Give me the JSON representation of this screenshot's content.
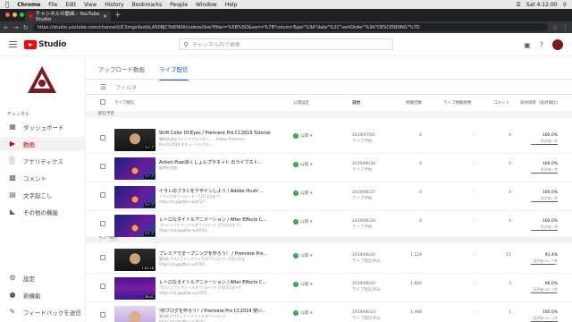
{
  "os_menu": {
    "app": "Chrome",
    "items": [
      "File",
      "Edit",
      "View",
      "History",
      "Bookmarks",
      "People",
      "Window",
      "Help"
    ],
    "clock": "Sat 4:12:00"
  },
  "browser": {
    "tab_title": "チャンネルの動画 - YouTube Studio",
    "url": "https://studio.youtube.com/channel/UCSmgx9sstkLAS0BJCYbEN0A/videos/live?filter=%5B%5D&sort=%7B\"columnType\"%3A\"date\"%2C\"sortOrder\"%3A\"DESCENDING\"%7D"
  },
  "header": {
    "logo_text": "Studio",
    "search_placeholder": "チャンネル内で検索"
  },
  "sidebar": {
    "section_label": "チャンネル",
    "items": [
      {
        "label": "ダッシュボード",
        "icon": "dashboard-icon"
      },
      {
        "label": "動画",
        "icon": "video-icon"
      },
      {
        "label": "アナリティクス",
        "icon": "analytics-icon"
      },
      {
        "label": "コメント",
        "icon": "comment-icon"
      },
      {
        "label": "文字起こし",
        "icon": "subtitles-icon"
      },
      {
        "label": "その他の機能",
        "icon": "more-features-icon"
      }
    ],
    "bottom_items": [
      {
        "label": "設定",
        "icon": "gear-icon"
      },
      {
        "label": "新機能",
        "icon": "whats-new-icon"
      },
      {
        "label": "フィードバックを送信",
        "icon": "feedback-icon"
      }
    ]
  },
  "content": {
    "tabs": [
      "アップロード動画",
      "ライブ配信"
    ],
    "active_tab": 1,
    "filter_label": "フィルタ",
    "columns": {
      "video": "ライブ配信",
      "visibility": "公開設定",
      "date": "日付",
      "views": "視聴回数",
      "live_views": "ライブ視聴者数",
      "comments": "コメント",
      "rating": "高評価率（低評価比）"
    },
    "sections": {
      "scheduled": "配信予定",
      "live": "ライブ配信"
    },
    "rows": [
      {
        "title": "Shift Color Of Eyes / Premiere Pro CC2019 Tutorial",
        "desc1": "簡易合成はプレミアプライダー。…Adobe Premiere",
        "desc2": "Pro CC2019 のチュートリアル…",
        "visibility": "公開",
        "date": "2019/07/01",
        "date_sub": "ライブ予約",
        "views": "0",
        "live": "–",
        "comments": "0",
        "rating": "100.0%",
        "rating_sub": "低評価 / 件",
        "rating_val": 1.0,
        "thumb": "face",
        "dur": "ライブ"
      },
      {
        "title": "Action Pixelあくしょんプラネット のライブスト…",
        "desc1": "説明を追加",
        "desc2": "",
        "visibility": "公開",
        "date": "2019/06/30",
        "date_sub": "ライブ予約",
        "views": "0",
        "live": "–",
        "comments": "0",
        "rating": "100.0%",
        "rating_sub": "低評価 / 件",
        "rating_val": 1.0,
        "thumb": "space",
        "dur": "ライブ"
      },
      {
        "title": "イラレのブラシをデザインしよう / Adobe Illustr…",
        "desc1": "ブラシがダウンロード（7月11日まで）",
        "desc2": "https://d.gigafile.nu/0727…",
        "visibility": "公開",
        "date": "2019/06/27",
        "date_sub": "ライブ予約",
        "views": "0",
        "live": "–",
        "comments": "0",
        "rating": "100.0%",
        "rating_sub": "低評価 / 件",
        "rating_val": 1.0,
        "thumb": "space",
        "dur": "ライブ"
      },
      {
        "title": "レトロなタイトルアニメーション / After Effects C…",
        "desc1": "プロジェクトファイルダウンロード【7月3日まで】",
        "desc2": "https://xd.gigafile.nu/0703…",
        "visibility": "公開",
        "date": "2019/06/24",
        "date_sub": "ライブ予約",
        "views": "0",
        "live": "–",
        "comments": "0",
        "rating": "100.0%",
        "rating_sub": "低評価 / 件",
        "rating_val": 1.0,
        "thumb": "space",
        "dur": "ライブ"
      },
      {
        "title": "プレミアでオープニングを作ろう！ / Premiere Pro…",
        "desc1": "素材&プロジェクトファイルダウンロード【7月3日ま",
        "desc2": "https://d.gigafile.nu/0703…",
        "visibility": "公開",
        "date": "2019/06/26",
        "date_sub": "ライブ配信済み",
        "views": "1,124",
        "live": "–",
        "comments": "11",
        "rating": "91.4%",
        "rating_sub": "高評価 32 / 3件",
        "rating_val": 0.914,
        "thumb": "face",
        "dur": "1:02:18"
      },
      {
        "title": "レトロなタイトルアニメーション / After Effects C…",
        "desc1": "プロジェクトファイルダウンロード【7月3日まで】",
        "desc2": "https://xd.gigafile.nu/0703…",
        "visibility": "公開",
        "date": "2019/06/24",
        "date_sub": "ライブ配信済み",
        "views": "1,604",
        "live": "–",
        "comments": "3",
        "rating": "96.0%",
        "rating_sub": "高評価 48 / 2件",
        "rating_val": 0.96,
        "thumb": "purple",
        "dur": "58:41"
      },
      {
        "title": "!秒ブログを作ろう！/ Premiere Pro CC2019 使い…",
        "desc1": "素材&プロジェクトファイルダウンロード",
        "desc2": "https://d.gigafile.nu/0630…",
        "visibility": "公開",
        "date": "2019/06/23",
        "date_sub": "ライブ配信済み",
        "views": "1,498",
        "live": "–",
        "comments": "1",
        "rating": "100.0%",
        "rating_sub": "高評価 30 / 0件",
        "rating_val": 1.0,
        "thumb": "face2",
        "dur": "1:10:02"
      }
    ]
  },
  "colors": {
    "accent": "#065fd4",
    "brand_red": "#ff0000",
    "public_green": "#2ba640",
    "active_nav": "#cc0000"
  }
}
